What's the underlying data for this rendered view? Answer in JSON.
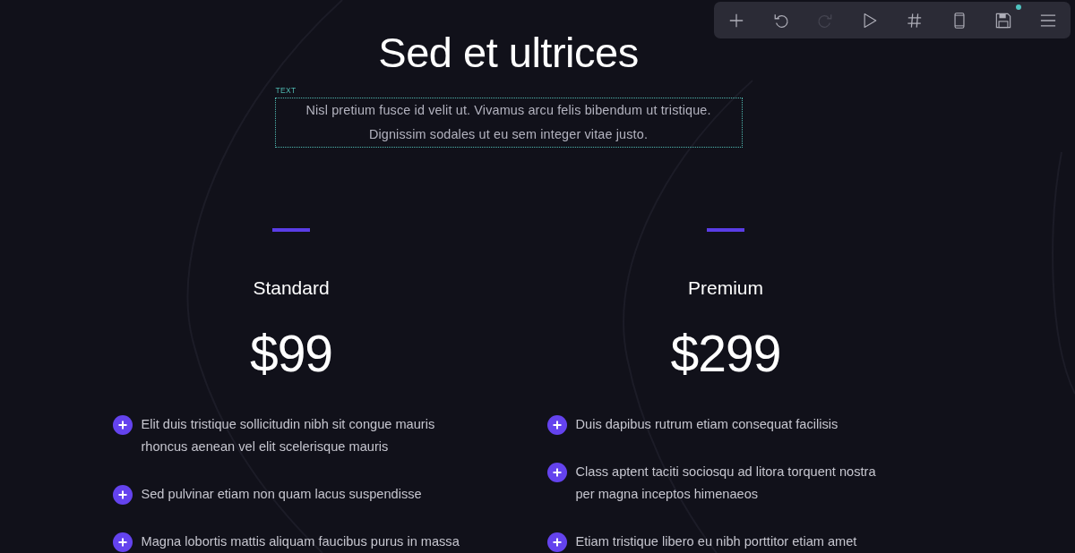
{
  "toolbar": {
    "buttons": [
      {
        "kind": "add",
        "disabled": false,
        "notification": false
      },
      {
        "kind": "undo",
        "disabled": false,
        "notification": false
      },
      {
        "kind": "redo",
        "disabled": true,
        "notification": false
      },
      {
        "kind": "preview",
        "disabled": false,
        "notification": false
      },
      {
        "kind": "grid",
        "disabled": false,
        "notification": false
      },
      {
        "kind": "mobile",
        "disabled": false,
        "notification": false
      },
      {
        "kind": "save",
        "disabled": false,
        "notification": true
      },
      {
        "kind": "menu",
        "disabled": false,
        "notification": false
      }
    ]
  },
  "header": {
    "title": "Sed et ultrices",
    "intro": {
      "text": "Nisl pretium fusce id velit ut. Vivamus arcu felis bibendum ut tristique. Dignissim sodales ut eu sem integer vitae justo.",
      "selected": true,
      "selection_label": "TEXT"
    }
  },
  "plans": [
    {
      "name": "Standard",
      "price": "$99",
      "features": [
        "Elit duis tristique sollicitudin nibh sit congue mauris rhoncus aenean vel elit scelerisque mauris",
        "Sed pulvinar etiam non quam lacus suspendisse",
        "Magna lobortis mattis aliquam faucibus purus in massa"
      ]
    },
    {
      "name": "Premium",
      "price": "$299",
      "features": [
        "Duis dapibus rutrum etiam consequat facilisis",
        "Class aptent taciti sociosqu ad litora torquent nostra per magna inceptos himenaeos",
        "Etiam tristique libero eu nibh porttitor etiam amet"
      ]
    }
  ]
}
